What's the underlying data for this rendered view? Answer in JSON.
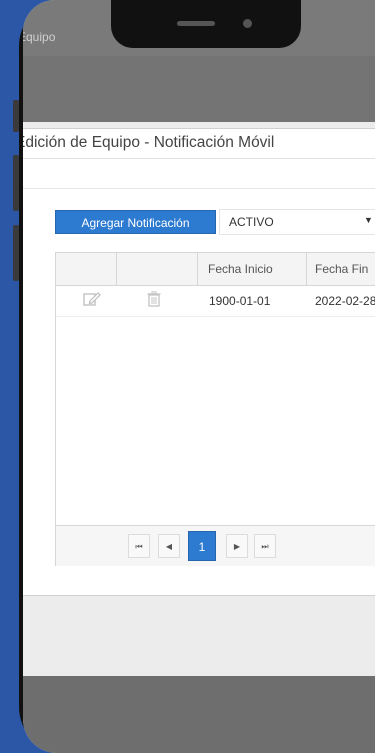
{
  "app": {
    "title": "Equipo"
  },
  "panel": {
    "title": "Edición de Equipo - Notificación Móvil"
  },
  "toolbar": {
    "add_label": "Agregar Notificación",
    "status_value": "ACTIVO",
    "caret": "▼"
  },
  "grid": {
    "columns": [
      "",
      "",
      "Fecha Inicio",
      "Fecha Fin"
    ],
    "rows": [
      {
        "fecha_inicio": "1900-01-01",
        "fecha_fin": "2022-02-28"
      }
    ]
  },
  "pager": {
    "first": "⏮",
    "prev": "◀",
    "current": "1",
    "next": "▶",
    "last": "⏭"
  },
  "icons": [
    "edit-icon",
    "trash-icon"
  ],
  "colors": {
    "accent": "#2d7bd0",
    "background": "#2b57a6"
  }
}
